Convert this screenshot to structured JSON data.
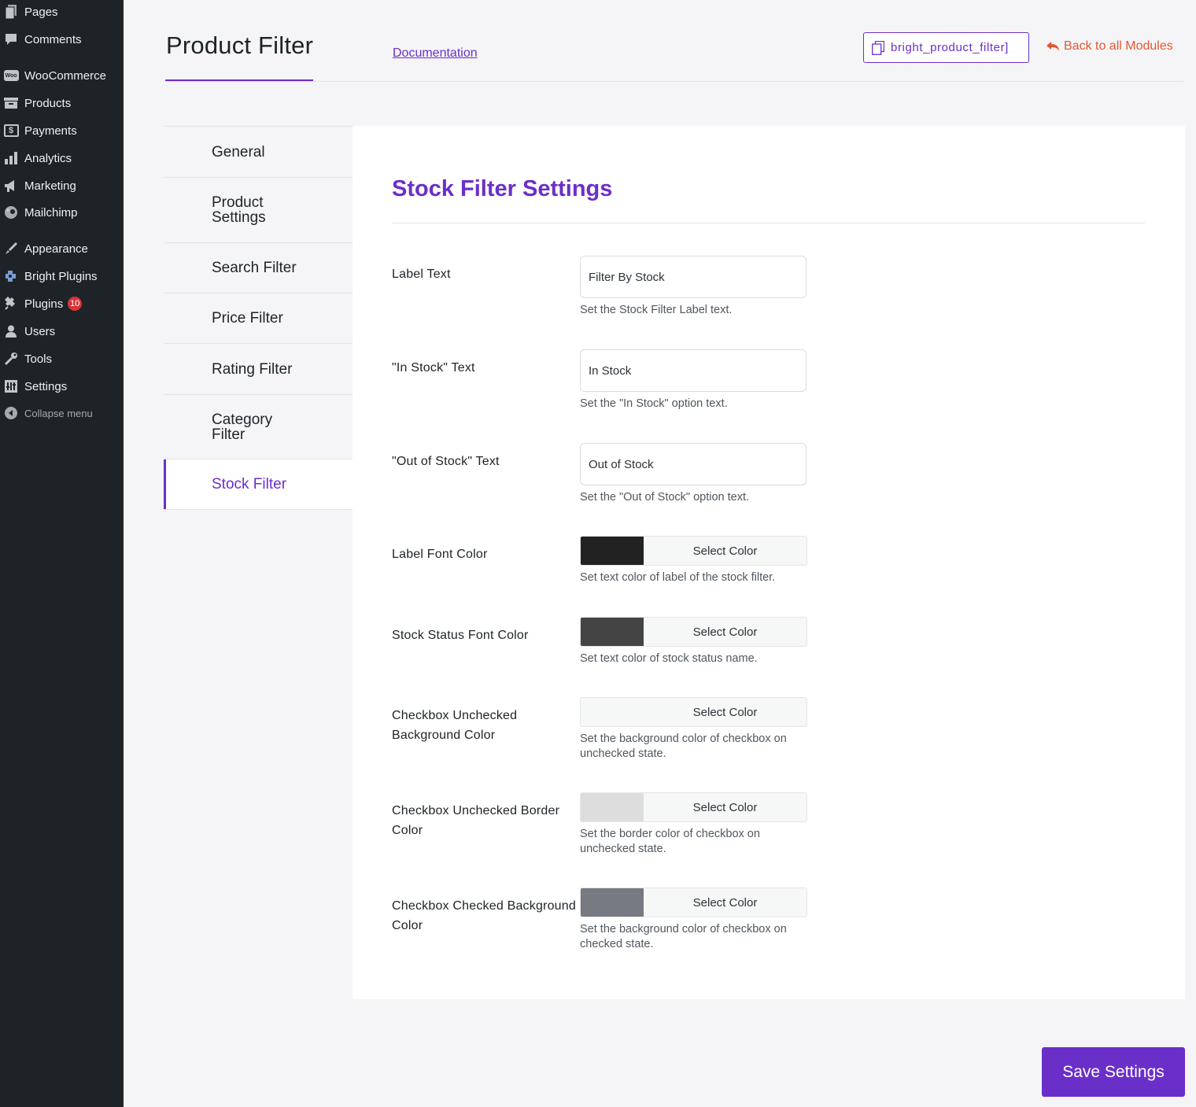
{
  "sidebar": {
    "items": [
      {
        "label": "Pages",
        "icon": "pages-icon"
      },
      {
        "label": "Comments",
        "icon": "comments-icon"
      },
      {
        "label": "WooCommerce",
        "icon": "woocommerce-icon",
        "icon_text": "Woo"
      },
      {
        "label": "Products",
        "icon": "products-icon"
      },
      {
        "label": "Payments",
        "icon": "payments-icon",
        "icon_text": "$"
      },
      {
        "label": "Analytics",
        "icon": "analytics-icon"
      },
      {
        "label": "Marketing",
        "icon": "marketing-icon"
      },
      {
        "label": "Mailchimp",
        "icon": "mailchimp-icon"
      },
      {
        "label": "Appearance",
        "icon": "appearance-icon"
      },
      {
        "label": "Bright Plugins",
        "icon": "bright-plugins-icon"
      },
      {
        "label": "Plugins",
        "icon": "plugins-icon",
        "badge": "10"
      },
      {
        "label": "Users",
        "icon": "users-icon"
      },
      {
        "label": "Tools",
        "icon": "tools-icon"
      },
      {
        "label": "Settings",
        "icon": "settings-icon"
      },
      {
        "label": "Collapse menu",
        "icon": "collapse-icon"
      }
    ]
  },
  "header": {
    "title": "Product Filter",
    "documentation_link": "Documentation",
    "shortcode": "bright_product_filter]",
    "back_link": "Back to all Modules"
  },
  "tabs": [
    {
      "label": "General"
    },
    {
      "label": "Product Settings"
    },
    {
      "label": "Search Filter"
    },
    {
      "label": "Price Filter"
    },
    {
      "label": "Rating Filter"
    },
    {
      "label": "Category Filter"
    },
    {
      "label": "Stock Filter",
      "active": true
    }
  ],
  "panel": {
    "title": "Stock Filter Settings",
    "fields": [
      {
        "label": "Label Text",
        "value": "Filter By Stock",
        "help": "Set the Stock Filter Label text."
      },
      {
        "label": "\"In Stock\" Text",
        "value": "In Stock",
        "help": "Set the \"In Stock\" option text."
      },
      {
        "label": "\"Out of Stock\" Text",
        "value": "Out of Stock",
        "help": "Set the \"Out of Stock\" option text."
      }
    ],
    "colors": [
      {
        "label": "Label Font Color",
        "button": "Select Color",
        "swatch": "#222222",
        "help": "Set text color of label of the stock filter."
      },
      {
        "label": "Stock Status Font Color",
        "button": "Select Color",
        "swatch": "#444444",
        "help": "Set text color of stock status name."
      },
      {
        "label": "Checkbox Unchecked Background Color",
        "button": "Select Color",
        "swatch": "",
        "help": "Set the background color of checkbox on unchecked state."
      },
      {
        "label": "Checkbox Unchecked Border Color",
        "button": "Select Color",
        "swatch": "#dddddd",
        "help": "Set the border color of checkbox on unchecked state."
      },
      {
        "label": "Checkbox Checked Background Color",
        "button": "Select Color",
        "swatch": "#777a80",
        "help": "Set the background color of checkbox on checked state."
      }
    ]
  },
  "save_button": "Save Settings",
  "theme": {
    "accent": "#6b2fc9",
    "back_link_color": "#e4572e",
    "sidebar_bg": "#1d2327"
  }
}
